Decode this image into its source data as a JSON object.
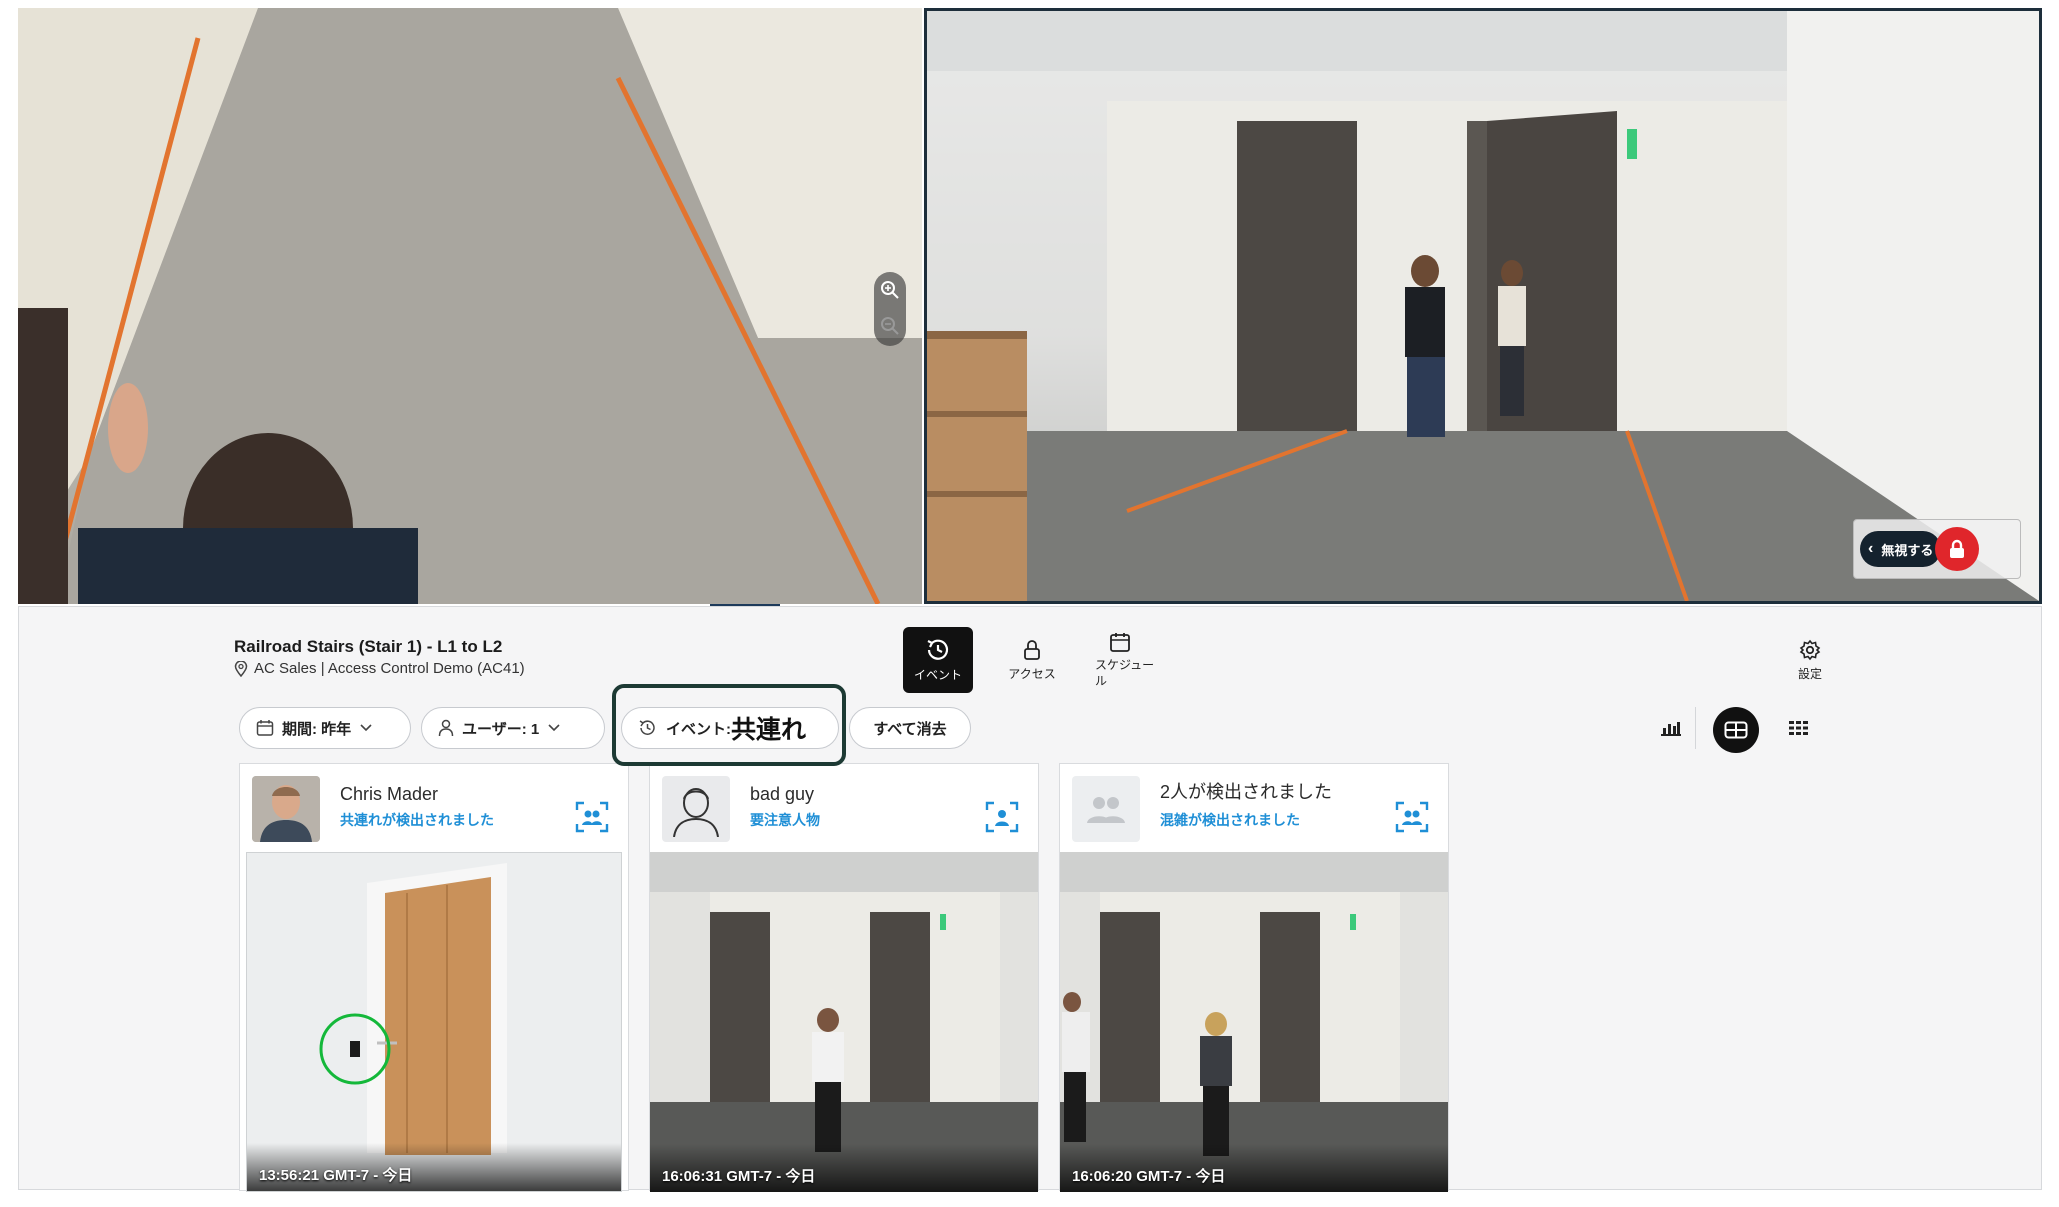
{
  "camera": {
    "zoom_in_label": "+",
    "ignore_label": "無視する"
  },
  "panel": {
    "door_title": "Railroad Stairs (Stair 1) - L1 to L2",
    "door_location": "AC Sales | Access Control Demo (AC41)",
    "tools": [
      {
        "label": "イベント",
        "active": true
      },
      {
        "label": "アクセス",
        "active": false
      },
      {
        "label": "スケジュー\nル",
        "active": false
      },
      {
        "label": "設定",
        "active": false
      }
    ],
    "filters": {
      "period": "期間: 昨年",
      "user": "ユーザー: 1",
      "event_prefix": "イベント: ",
      "event_value": "共連れ",
      "clear_all": "すべて消去"
    }
  },
  "cards": [
    {
      "name": "Chris Mader",
      "tag": "共連れが検出されました",
      "timestamp": "13:56:21 GMT-7 - 今日"
    },
    {
      "name": "bad guy",
      "tag": "要注意人物",
      "timestamp": "16:06:31 GMT-7 - 今日"
    },
    {
      "name": "2人が検出されました",
      "tag": "混雑が検出されました",
      "timestamp": "16:06:20 GMT-7 - 今日"
    }
  ],
  "colors": {
    "accent_blue": "#1f8fd6",
    "callout_dark": "#1d3a34",
    "arrow_navy": "#1d3a5a",
    "lock_red": "#e0262b"
  }
}
